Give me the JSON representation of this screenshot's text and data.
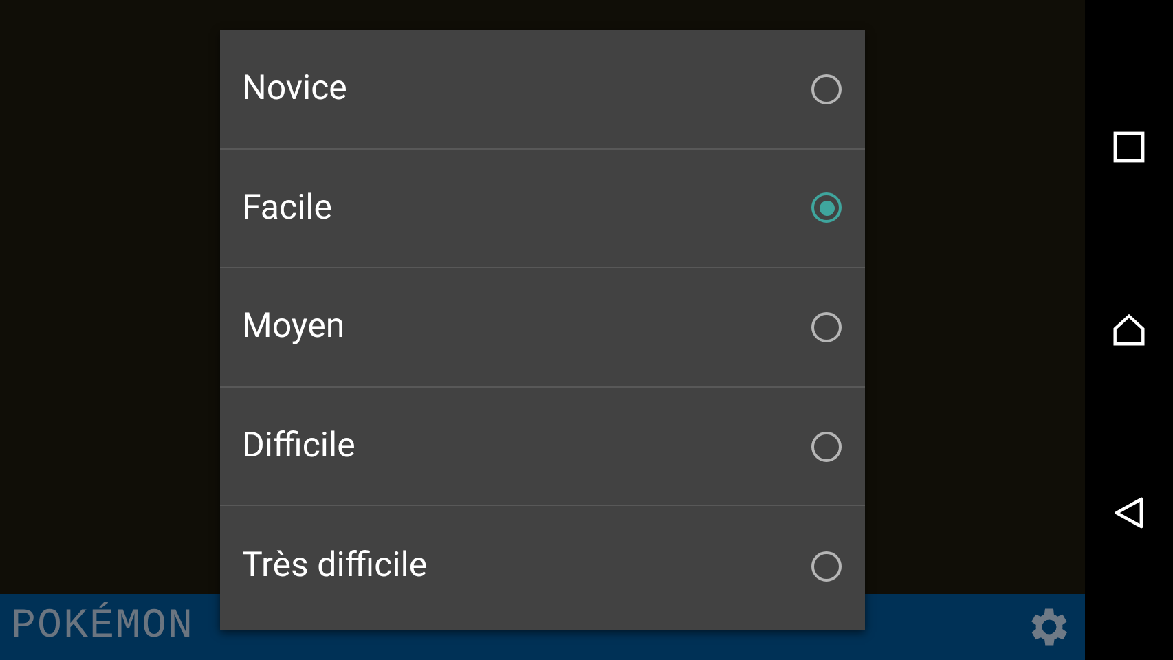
{
  "app_bar": {
    "title": "POKÉMON"
  },
  "dialog": {
    "options": [
      {
        "label": "Novice",
        "selected": false
      },
      {
        "label": "Facile",
        "selected": true
      },
      {
        "label": "Moyen",
        "selected": false
      },
      {
        "label": "Difficile",
        "selected": false
      },
      {
        "label": "Très difficile",
        "selected": false
      }
    ]
  }
}
